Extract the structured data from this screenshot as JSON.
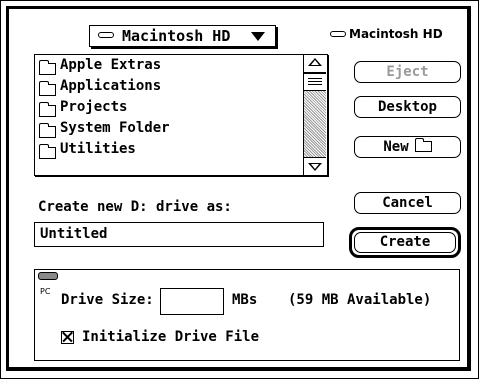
{
  "volume_popup": {
    "label": "Macintosh HD",
    "icon": "disk-icon"
  },
  "volume_name": "Macintosh HD",
  "files": [
    {
      "name": "Apple Extras",
      "icon": "folder-icon"
    },
    {
      "name": "Applications",
      "icon": "folder-icon"
    },
    {
      "name": "Projects",
      "icon": "folder-icon"
    },
    {
      "name": "System Folder",
      "icon": "folder-icon"
    },
    {
      "name": "Utilities",
      "icon": "folder-icon"
    }
  ],
  "buttons": {
    "eject": "Eject",
    "desktop": "Desktop",
    "new": "New",
    "cancel": "Cancel",
    "create": "Create"
  },
  "prompt": "Create new D: drive as:",
  "name_field": {
    "value": "Untitled"
  },
  "pc_options": {
    "badge": "PC",
    "drive_size_label": "Drive Size:",
    "drive_size_value": "",
    "unit": "MBs",
    "available": "(59 MB Available)",
    "initialize_label": "Initialize Drive File",
    "initialize_checked": true
  }
}
